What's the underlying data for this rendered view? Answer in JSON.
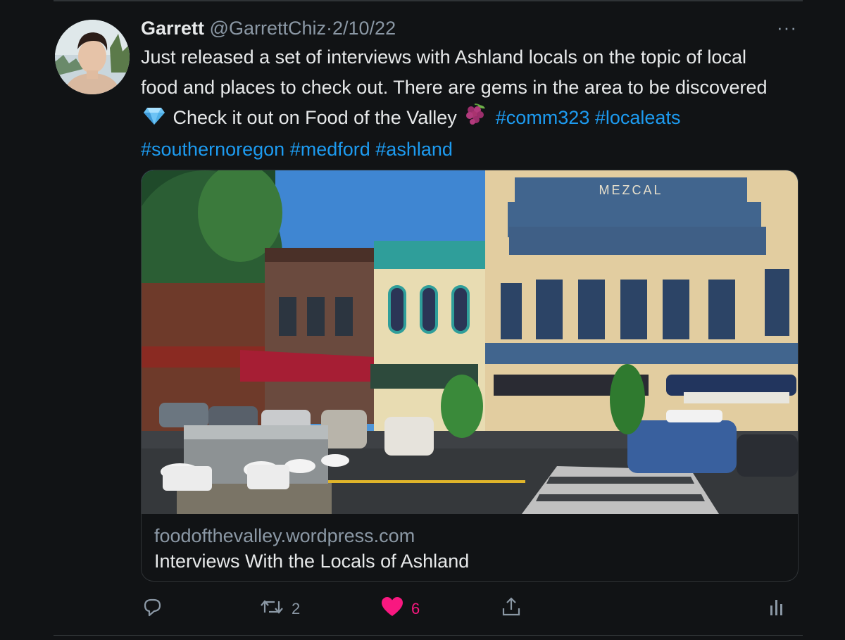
{
  "tweet": {
    "author_name": "Garrett",
    "handle": "@GarrettChiz",
    "separator": "·",
    "date": "2/10/22",
    "more_label": "···",
    "text_part1": "Just released a set of interviews with Ashland locals on the topic of local food and places to check out. There are gems in the area to be discovered",
    "text_part2": "Check it out on Food of the Valley",
    "hashtags": [
      "#comm323",
      "#localeats",
      "#southernoregon",
      "#medford",
      "#ashland"
    ],
    "emoji_1": "gem-stone",
    "emoji_2": "grapes"
  },
  "card": {
    "domain": "foodofthevalley.wordpress.com",
    "title": "Interviews With the Locals of Ashland",
    "image_sign_text": "MEZCAL"
  },
  "actions": {
    "reply_count": "",
    "retweet_count": "2",
    "like_count": "6",
    "liked": true
  },
  "colors": {
    "background": "#111315",
    "text": "#e7e9ea",
    "secondary": "#8b98a5",
    "link": "#1d9bf0",
    "like": "#f91880"
  }
}
